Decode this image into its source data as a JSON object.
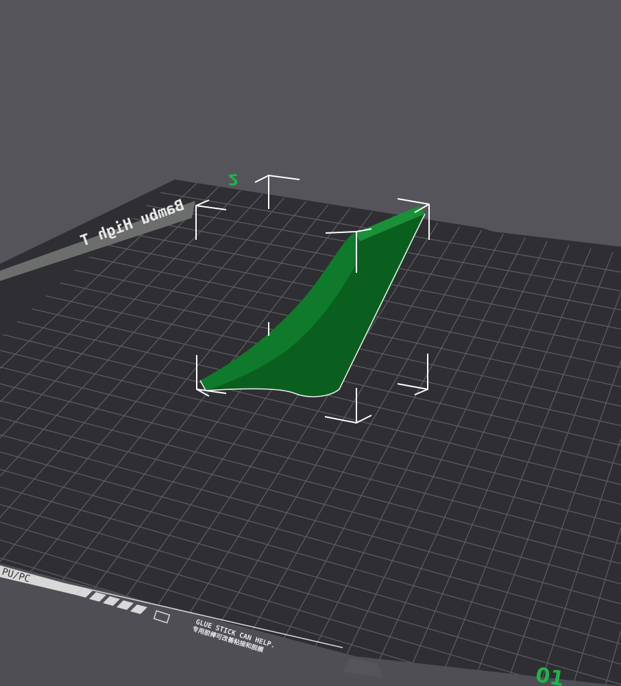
{
  "viewport": {
    "background_color": "#55545b",
    "plate_color": "#2f2e33",
    "grid_color": "#5c5b61",
    "object_color": "#0d6b24",
    "accent_color": "#1fb34a"
  },
  "plate": {
    "brand_label": "Bambu High T",
    "material_label": "PU/PC",
    "hint_en": "GLUE STICK CAN HELP.",
    "hint_zh": "专用胶棒可改善粘接和脱模",
    "plate_number": "01",
    "axis_label": "2"
  }
}
